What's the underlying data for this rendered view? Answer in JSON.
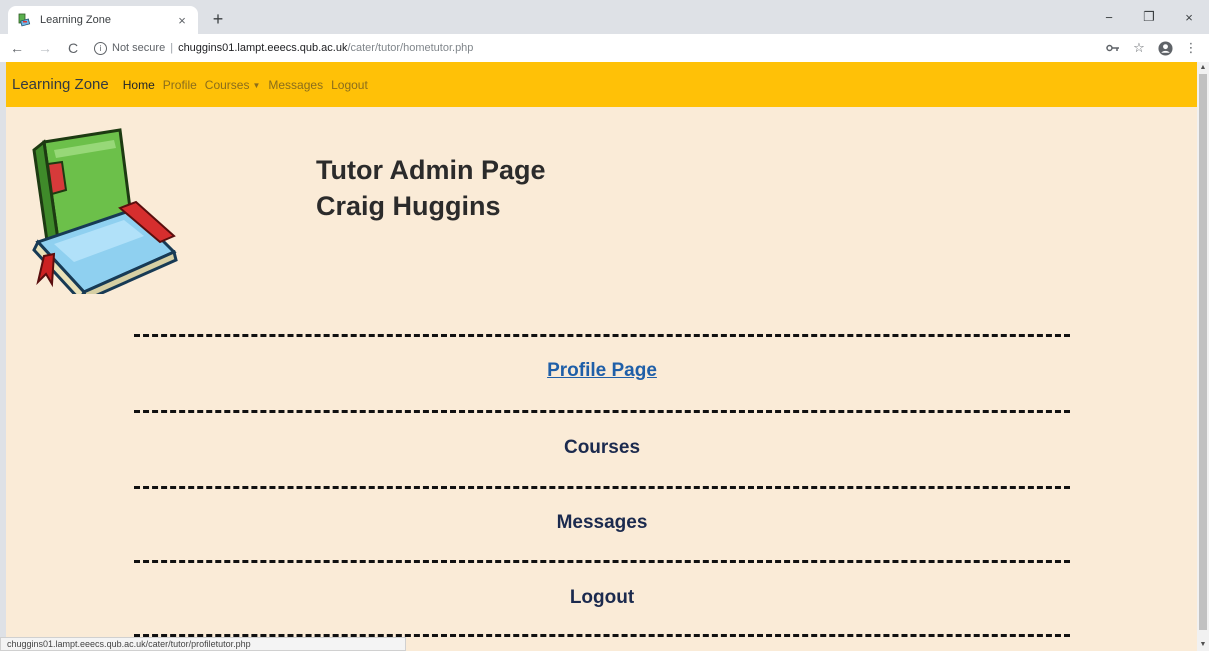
{
  "browser": {
    "tab_title": "Learning Zone",
    "tab_close": "×",
    "new_tab": "+",
    "window_controls": {
      "minimize": "−",
      "maximize": "❐",
      "close": "×"
    },
    "nav": {
      "back": "←",
      "forward": "→",
      "reload": "C"
    },
    "security_label": "Not secure",
    "separator": "|",
    "url_host": "chuggins01.lampt.eeecs.qub.ac.uk",
    "url_path": "/cater/tutor/hometutor.php",
    "toolbar_icons": {
      "key": "key-icon",
      "star": "star-icon",
      "account": "account-icon",
      "menu": "menu-icon"
    },
    "status_url": "chuggins01.lampt.eeecs.qub.ac.uk/cater/tutor/profiletutor.php"
  },
  "site": {
    "brand": "Learning Zone",
    "nav": {
      "home": "Home",
      "profile": "Profile",
      "courses": "Courses",
      "messages": "Messages",
      "logout": "Logout"
    },
    "colors": {
      "navbar": "#ffc107",
      "page_bg": "#faebd7",
      "link": "#1f5fa8"
    }
  },
  "page": {
    "title": "Tutor Admin Page",
    "user_name": "Craig Huggins",
    "menu": {
      "profile": "Profile Page",
      "courses": "Courses",
      "messages": "Messages",
      "logout": "Logout"
    }
  }
}
